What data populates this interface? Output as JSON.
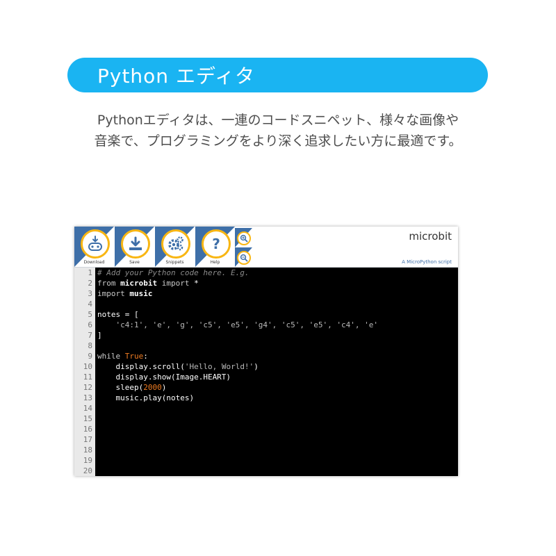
{
  "banner": {
    "title": "Python エディタ"
  },
  "description": {
    "line1": "Pythonエディタは、一連のコードスニペット、様々な画像や",
    "line2": "音楽で、プログラミングをより深く追求したい方に最適です。"
  },
  "editor": {
    "brand": "microbit",
    "subtitle": "A MicroPython script",
    "toolbar": [
      {
        "label": "Download",
        "icon": "microbit-download-icon"
      },
      {
        "label": "Save",
        "icon": "save-download-icon"
      },
      {
        "label": "Snippets",
        "icon": "gears-icon"
      },
      {
        "label": "Help",
        "icon": "question-icon"
      }
    ],
    "zoom_icons": [
      "zoom-in-icon",
      "zoom-out-icon"
    ],
    "line_numbers": [
      "1",
      "2",
      "3",
      "4",
      "5",
      "6",
      "7",
      "8",
      "9",
      "10",
      "11",
      "12",
      "13",
      "14",
      "15",
      "16",
      "17",
      "18",
      "19",
      "20"
    ],
    "code": {
      "l1": "# Add your Python code here. E.g.",
      "l2_kw1": "from ",
      "l2_mod": "microbit",
      "l2_kw2": " import ",
      "l2_rest": "*",
      "l3_kw": "import ",
      "l3_mod": "music",
      "l5": "notes = [",
      "l6_indent": "    ",
      "l6_items": "'c4:1', 'e', 'g', 'c5', 'e5', 'g4', 'c5', 'e5', 'c4', 'e'",
      "l7": "]",
      "l9_kw": "while ",
      "l9_const": "True",
      "l9_rest": ":",
      "l10_pre": "    display.scroll(",
      "l10_str": "'Hello, World!'",
      "l10_post": ")",
      "l11": "    display.show(Image.HEART)",
      "l12_pre": "    sleep(",
      "l12_num": "2000",
      "l12_post": ")",
      "l13": "    music.play(notes)"
    }
  }
}
